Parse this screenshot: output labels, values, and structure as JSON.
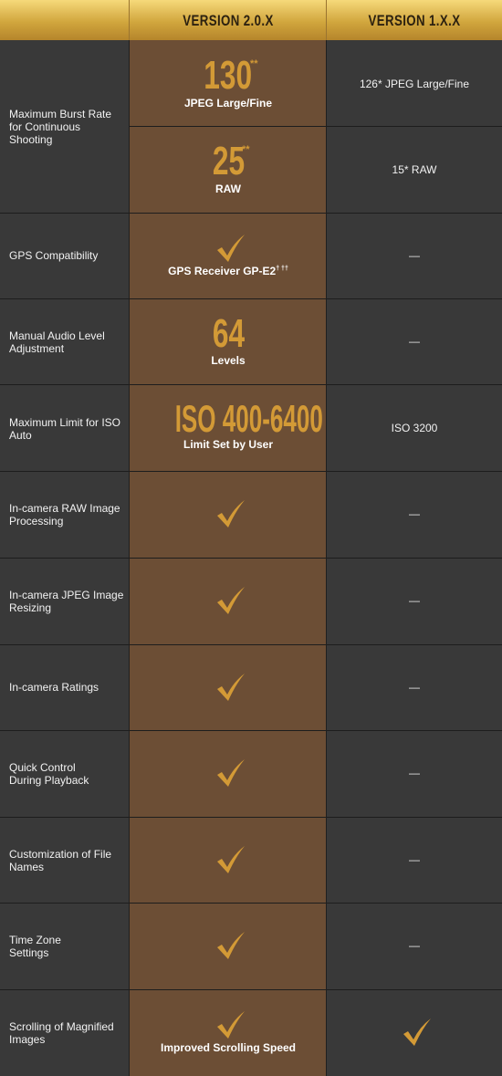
{
  "header": {
    "v2": "VERSION 2.0.X",
    "v1": "VERSION 1.X.X"
  },
  "rows": {
    "burst": {
      "label": "Maximum Burst Rate for Continuous Shooting",
      "jpeg_value": "130",
      "jpeg_mark": "**",
      "jpeg_caption": "JPEG Large/Fine",
      "raw_value": "25",
      "raw_mark": "**",
      "raw_caption": "RAW",
      "v1_jpeg": "126* JPEG Large/Fine",
      "v1_raw": "15* RAW"
    },
    "gps": {
      "label": "GPS Compatibility",
      "caption": "GPS Receiver GP-E2",
      "caption_mark": "† ††",
      "v1": "—"
    },
    "audio": {
      "label": "Manual Audio Level Adjustment",
      "value": "64",
      "caption": "Levels",
      "v1": "—"
    },
    "iso": {
      "label": "Maximum Limit for ISO Auto",
      "value": "ISO 400-6400",
      "caption": "Limit Set by User",
      "v1": "ISO 3200"
    },
    "raw_proc": {
      "label": "In-camera RAW Image Processing",
      "v1": "—"
    },
    "jpeg_resize": {
      "label": "In-camera JPEG Image Resizing",
      "v1": "—"
    },
    "ratings": {
      "label": "In-camera Ratings",
      "v1": "—"
    },
    "quick": {
      "label": "Quick Control During Playback",
      "v1": "—"
    },
    "filenames": {
      "label": "Customization of File Names",
      "v1": "—"
    },
    "timezone": {
      "label": "Time Zone Settings",
      "v1": "—"
    },
    "scroll": {
      "label": "Scrolling of Magnified Images",
      "caption": "Improved Scrolling Speed"
    }
  },
  "colors": {
    "accent": "#d39a36",
    "highlight_column": "#6c4e35",
    "cell": "#393939",
    "header_gold": "#d1a63d"
  },
  "icons": {
    "check": "check-icon"
  }
}
